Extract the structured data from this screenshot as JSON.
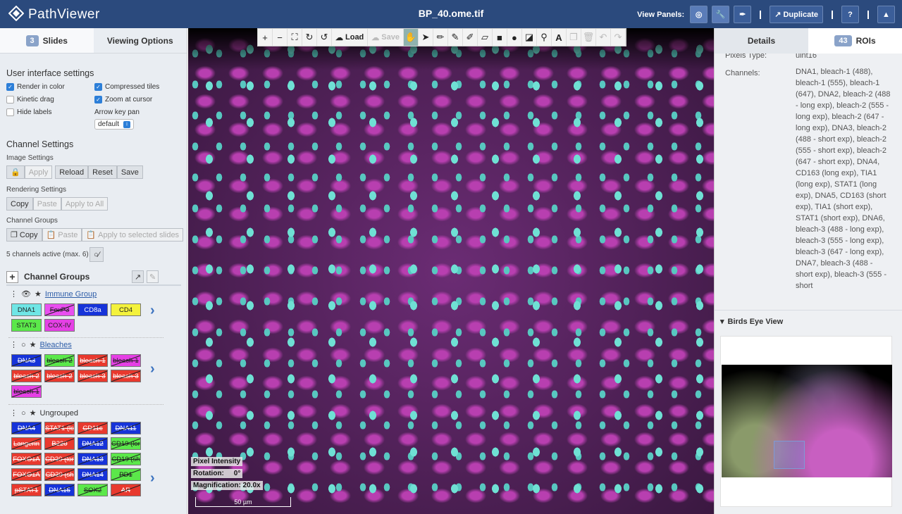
{
  "app": {
    "name": "PathViewer",
    "file": "BP_40.ome.tif"
  },
  "topbar": {
    "view_panels_label": "View Panels:",
    "duplicate_label": "Duplicate",
    "help_label": "?"
  },
  "left": {
    "tabs": [
      {
        "count": "3",
        "label": "Slides"
      },
      {
        "label": "Viewing Options"
      }
    ],
    "ui_settings_title": "User interface settings",
    "options": [
      {
        "label": "Render in color",
        "checked": true
      },
      {
        "label": "Compressed tiles",
        "checked": true
      },
      {
        "label": "Kinetic drag",
        "checked": false
      },
      {
        "label": "Zoom at cursor",
        "checked": true
      },
      {
        "label": "Hide labels",
        "checked": false
      }
    ],
    "arrow_key_pan_label": "Arrow key pan",
    "arrow_key_pan_value": "default",
    "channel_settings_title": "Channel Settings",
    "image_settings_label": "Image Settings",
    "image_buttons": [
      "Apply",
      "Reload",
      "Reset",
      "Save"
    ],
    "rendering_settings_label": "Rendering Settings",
    "rendering_buttons": [
      "Copy",
      "Paste",
      "Apply to All"
    ],
    "channel_groups_label": "Channel Groups",
    "group_buttons": [
      "Copy",
      "Paste",
      "Apply to selected slides"
    ],
    "active_text": "5 channels active (max. 6)",
    "cg_header": "Channel Groups",
    "groups": [
      {
        "name": "Immune Group",
        "chips": [
          {
            "t": "DNA1",
            "bg": "#6fe6e6",
            "x": false
          },
          {
            "t": "FoxP3",
            "bg": "#e94ff0",
            "x": true
          },
          {
            "t": "CD8a",
            "bg": "#1633d9",
            "x": false
          },
          {
            "t": "CD4",
            "bg": "#f4f23c",
            "x": false
          },
          {
            "t": "STAT3",
            "bg": "#5be84a",
            "x": false
          },
          {
            "t": "COX-IV",
            "bg": "#e540e5",
            "x": false
          }
        ]
      },
      {
        "name": "Bleaches",
        "chips": [
          {
            "t": "DNA3",
            "bg": "#1633d9",
            "x": true
          },
          {
            "t": "bleach-2",
            "bg": "#5be84a",
            "x": true
          },
          {
            "t": "bleach-1",
            "bg": "#e8392e",
            "x": true
          },
          {
            "t": "bleach-1",
            "bg": "#e540e5",
            "x": true
          },
          {
            "t": "bleach-2",
            "bg": "#e8392e",
            "x": true
          },
          {
            "t": "bleach-2",
            "bg": "#e8392e",
            "x": true
          },
          {
            "t": "bleach-3",
            "bg": "#e8392e",
            "x": true
          },
          {
            "t": "bleach-3",
            "bg": "#e8392e",
            "x": true
          },
          {
            "t": "bleach-1",
            "bg": "#e540e5",
            "x": true
          }
        ]
      },
      {
        "name": "Ungrouped",
        "chips": [
          {
            "t": "DNA4",
            "bg": "#1633d9",
            "x": true
          },
          {
            "t": "STAT1 (lc",
            "bg": "#e8392e",
            "x": true
          },
          {
            "t": "CD11c",
            "bg": "#e8392e",
            "x": true
          },
          {
            "t": "DNA11",
            "bg": "#1633d9",
            "x": true
          },
          {
            "t": "Langerin",
            "bg": "#e8392e",
            "x": true
          },
          {
            "t": "B220",
            "bg": "#e8392e",
            "x": true
          },
          {
            "t": "DNA12",
            "bg": "#1633d9",
            "x": true
          },
          {
            "t": "CD19 (lor",
            "bg": "#5be84a",
            "x": true
          },
          {
            "t": "FOXO1A",
            "bg": "#e8392e",
            "x": true
          },
          {
            "t": "CD20 (lor",
            "bg": "#e8392e",
            "x": true
          },
          {
            "t": "DNA13",
            "bg": "#1633d9",
            "x": true
          },
          {
            "t": "CD19 (sh",
            "bg": "#5be84a",
            "x": true
          },
          {
            "t": "FOXO1A",
            "bg": "#e8392e",
            "x": true
          },
          {
            "t": "CD20 (sh",
            "bg": "#e8392e",
            "x": true
          },
          {
            "t": "DNA14",
            "bg": "#1633d9",
            "x": true
          },
          {
            "t": "PD1",
            "bg": "#5be84a",
            "x": true
          },
          {
            "t": "pSTAT1",
            "bg": "#e8392e",
            "x": true
          },
          {
            "t": "DNA15",
            "bg": "#1633d9",
            "x": true
          },
          {
            "t": "SOX2",
            "bg": "#5be84a",
            "x": true
          },
          {
            "t": "AR",
            "bg": "#e8392e",
            "x": true
          }
        ]
      }
    ]
  },
  "viewer": {
    "load_label": "Load",
    "save_label": "Save",
    "pixel_intensity": "Pixel Intensity",
    "rotation": "Rotation:     0°",
    "magnification": "Magnification: 20.0x",
    "scale_label": "50 µm"
  },
  "right": {
    "tabs": [
      {
        "label": "Details"
      },
      {
        "count": "43",
        "label": "ROIs"
      }
    ],
    "pixels_type_label": "Pixels Type:",
    "pixels_type_value": "uint16",
    "channels_label": "Channels:",
    "channels_value": "DNA1, bleach-1 (488), bleach-1 (555), bleach-1 (647), DNA2, bleach-2 (488 - long exp), bleach-2 (555 - long exp), bleach-2 (647 - long exp), DNA3, bleach-2 (488 - short exp), bleach-2 (555 - short exp), bleach-2 (647 - short exp), DNA4, CD163 (long exp), TIA1 (long exp), STAT1 (long exp), DNA5, CD163 (short exp), TIA1 (short exp), STAT1 (short exp), DNA6, bleach-3 (488 - long exp), bleach-3 (555 - long exp), bleach-3 (647 - long exp), DNA7, bleach-3 (488 - short exp), bleach-3 (555 - short",
    "birds_eye_label": "Birds Eye View"
  }
}
